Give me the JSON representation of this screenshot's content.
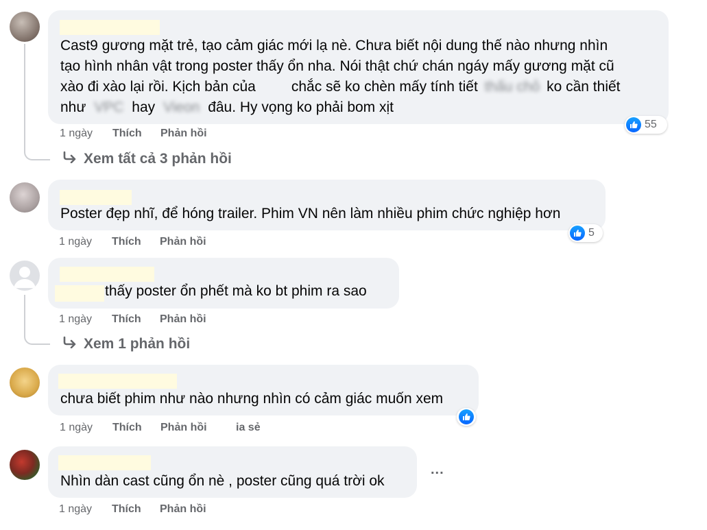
{
  "meta_labels": {
    "time": "1 ngày",
    "like": "Thích",
    "reply": "Phản hồi"
  },
  "comments": [
    {
      "lines": [
        "Cast9 gương mặt trẻ, tạo cảm giác mới lạ nè. Chưa biết nội dung thế nào nhưng nhìn",
        "tạo hình nhân vật trong poster thấy ổn nha. Nói thật chứ chán ngáy mấy gương mặt cũ",
        "xào đi xào lại rồi. Kịch bản của"
      ],
      "line3_b": "chắc sẽ ko chèn mấy tính tiết",
      "line3_blur": "thấu chỏ",
      "line3_c": "ko cần thiết",
      "line4_a": "như",
      "line4_blur1": "VPC",
      "line4_b": "hay",
      "line4_blur2": "Vieon",
      "line4_c": "đâu. Hy vọng ko phải bom xịt",
      "reaction_count": "55",
      "view_replies": "Xem tất cả 3 phản hồi"
    },
    {
      "text": "Poster đẹp nhĩ, để hóng trailer. Phim VN nên làm nhiều phim chức nghiệp hơn",
      "reaction_count": "5"
    },
    {
      "text": "thấy poster ổn phết mà ko bt phim ra sao",
      "view_replies": "Xem 1 phản hồi"
    },
    {
      "text": "chưa biết phim như nào nhưng nhìn có cảm giác muốn xem",
      "share_partial": "ia sẻ"
    },
    {
      "text": "Nhìn dàn cast cũng ổn nè , poster cũng quá trời ok",
      "more": "..."
    }
  ],
  "colors": {
    "like_blue": "#0866ff",
    "bubble": "#f0f2f5",
    "meta": "#65676b",
    "name_redaction": "#fffbe0"
  },
  "icons": [
    "like-icon",
    "reply-arrow-icon",
    "more-options-icon"
  ]
}
